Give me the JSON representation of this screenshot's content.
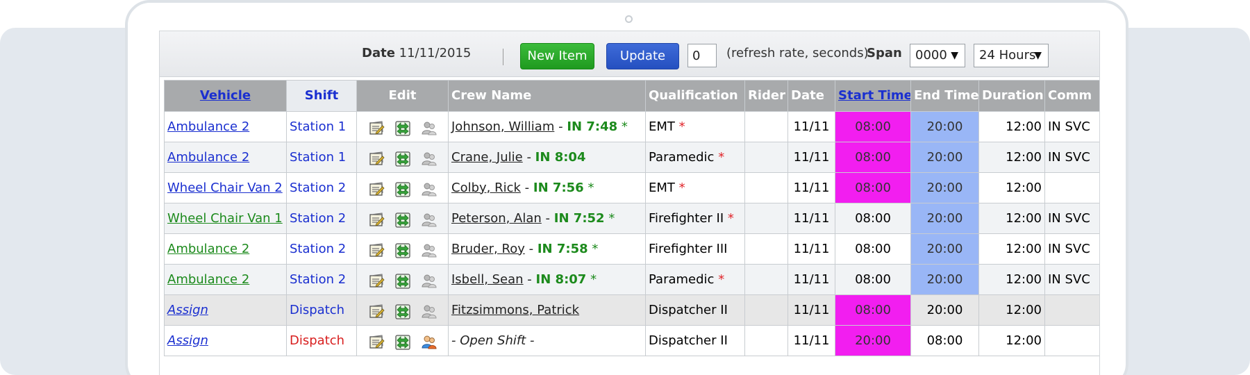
{
  "toolbar": {
    "date_label": "Date",
    "date_value": "11/11/2015",
    "new_item_label": "New Item",
    "update_label": "Update",
    "refresh_value": "0",
    "refresh_text": "(refresh rate, seconds)",
    "span_label": "Span",
    "span_value": "0000",
    "hours_value": "24 Hours"
  },
  "columns": [
    "Vehicle",
    "Shift",
    "Edit",
    "Crew Name",
    "Qualification",
    "Rider",
    "Date",
    "Start Time",
    "End Time",
    "Duration",
    "Comm"
  ],
  "rows": [
    {
      "vehicle": "Ambulance 2",
      "shift": "Station 1",
      "crew": "Johnson, William",
      "in": "IN 7:48",
      "star": "*",
      "qual": "EMT",
      "qstar": "*",
      "date": "11/11",
      "start": "08:00",
      "end": "20:00",
      "dur": "12:00",
      "comm": "IN SVC"
    },
    {
      "vehicle": "Ambulance 2",
      "shift": "Station 1",
      "crew": "Crane, Julie",
      "in": "IN 8:04",
      "star": "",
      "qual": "Paramedic",
      "qstar": "*",
      "date": "11/11",
      "start": "08:00",
      "end": "20:00",
      "dur": "12:00",
      "comm": "IN SVC"
    },
    {
      "vehicle": "Wheel Chair Van 2",
      "shift": "Station 2",
      "crew": "Colby, Rick",
      "in": "IN 7:56",
      "star": "*",
      "qual": "EMT",
      "qstar": "*",
      "date": "11/11",
      "start": "08:00",
      "end": "20:00",
      "dur": "12:00",
      "comm": ""
    },
    {
      "vehicle": "Wheel Chair Van 1",
      "shift": "Station 2",
      "crew": "Peterson, Alan",
      "in": "IN 7:52",
      "star": "*",
      "qual": "Firefighter II",
      "qstar": "*",
      "date": "11/11",
      "start": "08:00",
      "end": "20:00",
      "dur": "12:00",
      "comm": "IN SVC"
    },
    {
      "vehicle": "Ambulance 2",
      "shift": "Station 2",
      "crew": "Bruder, Roy",
      "in": "IN 7:58",
      "star": "*",
      "qual": "Firefighter III",
      "qstar": "",
      "date": "11/11",
      "start": "08:00",
      "end": "20:00",
      "dur": "12:00",
      "comm": "IN SVC"
    },
    {
      "vehicle": "Ambulance 2",
      "shift": "Station 2",
      "crew": "Isbell, Sean",
      "in": "IN 8:07",
      "star": "*",
      "qual": "Paramedic",
      "qstar": "*",
      "date": "11/11",
      "start": "08:00",
      "end": "20:00",
      "dur": "12:00",
      "comm": "IN SVC"
    },
    {
      "vehicle": "Assign",
      "shift": "Dispatch",
      "crew": "Fitzsimmons, Patrick",
      "in": "",
      "star": "",
      "qual": "Dispatcher II",
      "qstar": "",
      "date": "11/11",
      "start": "08:00",
      "end": "20:00",
      "dur": "12:00",
      "comm": ""
    },
    {
      "vehicle": "Assign",
      "shift": "Dispatch",
      "crew": "- Open Shift -",
      "in": "",
      "star": "",
      "qual": "Dispatcher II",
      "qstar": "",
      "date": "11/11",
      "start": "20:00",
      "end": "08:00",
      "dur": "12:00",
      "comm": ""
    }
  ],
  "colors": {
    "start_highlight": "#f21ef0",
    "end_highlight": "#99b6f6",
    "new_button": "#2aab2a",
    "update_button": "#2f5bcc"
  },
  "icons": [
    "note-edit-icon",
    "swap-arrows-icon",
    "crew-person-icon"
  ]
}
